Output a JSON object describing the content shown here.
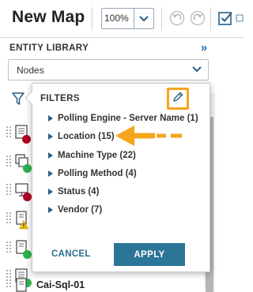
{
  "toolbar": {
    "title": "New Map",
    "zoom_value": "100%",
    "icons": [
      "chevron-down-icon",
      "undo-icon",
      "redo-icon",
      "checkbox-icon",
      "save-icon"
    ]
  },
  "entity_library": {
    "title": "ENTITY LIBRARY",
    "collapse_label": "»",
    "type_select_value": "Nodes",
    "nodes": [
      {
        "label": "",
        "status": "down"
      },
      {
        "label": "",
        "status": "up"
      },
      {
        "label": "",
        "status": "down"
      },
      {
        "label": "",
        "status": "warning"
      },
      {
        "label": "",
        "status": "up"
      },
      {
        "label": "",
        "status": "up"
      },
      {
        "label": "Cai-Sql-01",
        "status": "none"
      }
    ]
  },
  "filters": {
    "title": "FILTERS",
    "items": [
      {
        "label": "Polling Engine - Server Name (1)"
      },
      {
        "label": "Location (15)"
      },
      {
        "label": "Machine Type (22)"
      },
      {
        "label": "Polling Method (4)"
      },
      {
        "label": "Status (4)"
      },
      {
        "label": "Vendor (7)"
      }
    ],
    "cancel_label": "CANCEL",
    "apply_label": "APPLY"
  },
  "colors": {
    "accent": "#2b7596",
    "highlight": "#f5a51c",
    "status_up": "#2bb24c",
    "status_down": "#b00020",
    "status_warning": "#f5c400"
  }
}
